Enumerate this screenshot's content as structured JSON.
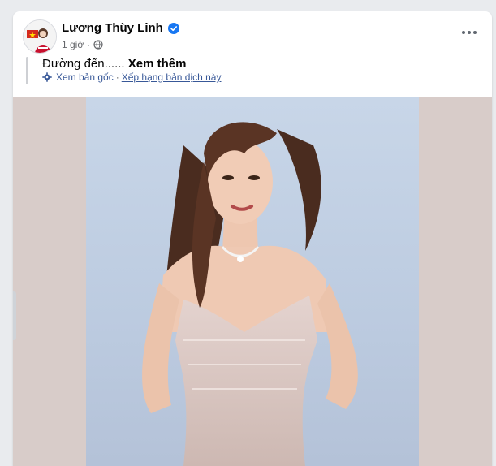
{
  "post": {
    "author": "Lương Thùy Linh",
    "verified": true,
    "time": "1 giờ",
    "privacy_icon": "globe-icon",
    "text": "Đường đến......",
    "see_more": "Xem thêm",
    "translate": {
      "view_original": "Xem bản gốc",
      "separator": "·",
      "rate_translation": "Xếp hạng bản dịch này"
    }
  },
  "colors": {
    "card_bg": "#ffffff",
    "link": "#385898",
    "verified": "#1877f2",
    "media_bg": "#d8ccc9",
    "photo_bg": "#c8d6e8"
  }
}
